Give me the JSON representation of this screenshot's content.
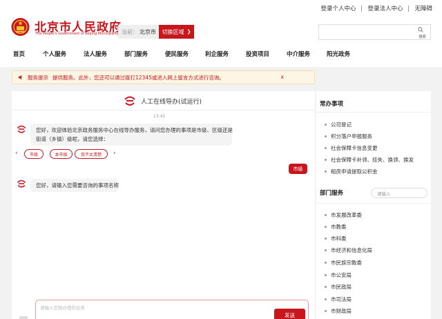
{
  "top_links": [
    "登录个人中心",
    "登录法人中心",
    "无障碍"
  ],
  "logo": {
    "cn": "北京市人民政府",
    "en": "The People's Government of Beijing Municipality"
  },
  "location": {
    "label": "当前：",
    "value": "北京市",
    "switch_label": "切换区域"
  },
  "search": {
    "button_label": "搜索"
  },
  "nav": [
    "首页",
    "个人服务",
    "法人服务",
    "部门服务",
    "便民服务",
    "利企服务",
    "投资项目",
    "中介服务",
    "阳光政务"
  ],
  "notice": {
    "label": "服务提示",
    "text": "提供服务。此外，您还可以通过拨打12345或进入网上留言方式进行咨询。",
    "close": "x"
  },
  "chat": {
    "title": "人工在线导办(试运行)",
    "time": "13:42",
    "bot_msg_1_line1": "您好，欢迎体验北京政务服务中心在线导办服务，请问您办理的事项是市级、区级还是",
    "bot_msg_1_line2": "街道（乡镇）级呢，请您选择：",
    "chips": [
      "市级",
      "本市级",
      "我不太清楚"
    ],
    "user_reply": "市级",
    "bot_msg_2": "您好，请输入您需要咨询的事项名称",
    "input_placeholder": "请输入您想办理的业务",
    "send_label": "发送"
  },
  "sidebar": {
    "common_title": "常办事项",
    "common_items": [
      "公司登记",
      "积分落户申报服务",
      "社会保障卡信息变更",
      "社会保障卡补领、挂失、换领、换发",
      "租房申请提取公积金"
    ],
    "dept_title": "部门服务",
    "dept_search_placeholder": "请输入",
    "dept_items": [
      "市发展改革委",
      "市教委",
      "市科委",
      "市经济和信息化局",
      "市民族宗教委",
      "市公安局",
      "市民政局",
      "市司法局",
      "市财政局"
    ]
  },
  "colors": {
    "brand": "#c8161d",
    "notice_bg": "#fdf6e4"
  }
}
